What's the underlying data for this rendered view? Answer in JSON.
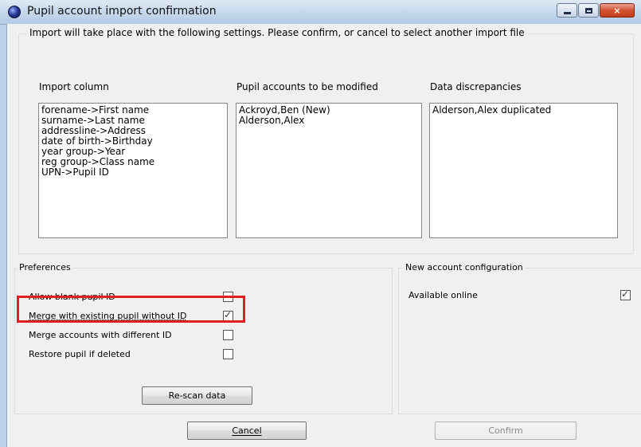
{
  "window": {
    "title": "Pupil account import confirmation",
    "controls": {
      "minimize": "minimize",
      "maximize": "maximize",
      "close": "×"
    }
  },
  "settings": {
    "legend": "Import will take place with the following settings. Please confirm, or cancel to select another import file",
    "columns": [
      {
        "header": "Import column",
        "items": [
          "forename->First name",
          "surname->Last name",
          "addressline->Address",
          "date of birth->Birthday",
          "year group->Year",
          "reg group->Class name",
          "UPN->Pupil ID"
        ]
      },
      {
        "header": "Pupil accounts to be modified",
        "items": [
          "Ackroyd,Ben (New)",
          "Alderson,Alex"
        ]
      },
      {
        "header": "Data discrepancies",
        "items": [
          "Alderson,Alex duplicated"
        ]
      }
    ]
  },
  "preferences": {
    "legend": "Preferences",
    "options": [
      {
        "label": "Allow blank pupil ID",
        "checked": false
      },
      {
        "label": "Merge with existing pupil without ID",
        "checked": true
      },
      {
        "label": "Merge accounts with different ID",
        "checked": false
      },
      {
        "label": "Restore pupil if deleted",
        "checked": false
      }
    ],
    "rescan_label": "Re-scan data"
  },
  "new_account": {
    "legend": "New account configuration",
    "options": [
      {
        "label": "Available online",
        "checked": true
      }
    ]
  },
  "buttons": {
    "cancel": "Cancel",
    "confirm": "Confirm"
  },
  "highlight_color": "#e02020"
}
